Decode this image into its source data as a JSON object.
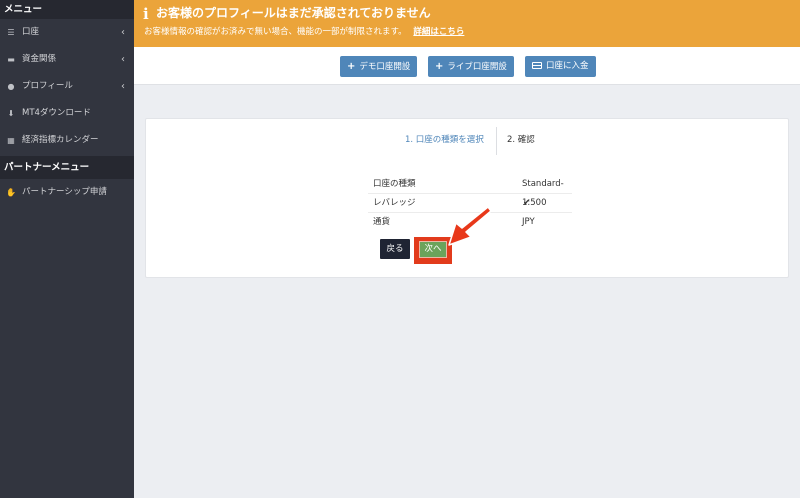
{
  "sidebar": {
    "menu_header": "メニュー",
    "items": [
      {
        "label": "口座",
        "icon": "list-icon",
        "has_chevron": true
      },
      {
        "label": "資金関係",
        "icon": "wallet-icon",
        "has_chevron": true
      },
      {
        "label": "プロフィール",
        "icon": "user-icon",
        "has_chevron": true
      },
      {
        "label": "MT4ダウンロード",
        "icon": "download-icon",
        "has_chevron": false
      },
      {
        "label": "経済指標カレンダー",
        "icon": "calendar-icon",
        "has_chevron": false
      }
    ],
    "partner_header": "パートナーメニュー",
    "partner_items": [
      {
        "label": "パートナーシップ申請",
        "icon": "handshake-icon"
      }
    ]
  },
  "alert": {
    "title": "お客様のプロフィールはまだ承認されておりません",
    "body": "お客様情報の確認がお済みで無い場合、機能の一部が制限されます。",
    "link": "詳細はこちら",
    "color": "#eba43a"
  },
  "toolbar": {
    "demo_button": "デモ口座開設",
    "live_button": "ライブ口座開設",
    "deposit_button": "口座に入金",
    "button_color": "#4f86b9"
  },
  "steps": {
    "step1": "1. 口座の種類を選択",
    "step2": "2. 確認"
  },
  "account": {
    "rows": [
      {
        "key": "口座の種類",
        "value": "Standard-",
        "check": "✔"
      },
      {
        "key": "レバレッジ",
        "value": "1:500"
      },
      {
        "key": "通貨",
        "value": "JPY"
      }
    ]
  },
  "actions": {
    "back": "戻る",
    "next": "次へ"
  }
}
